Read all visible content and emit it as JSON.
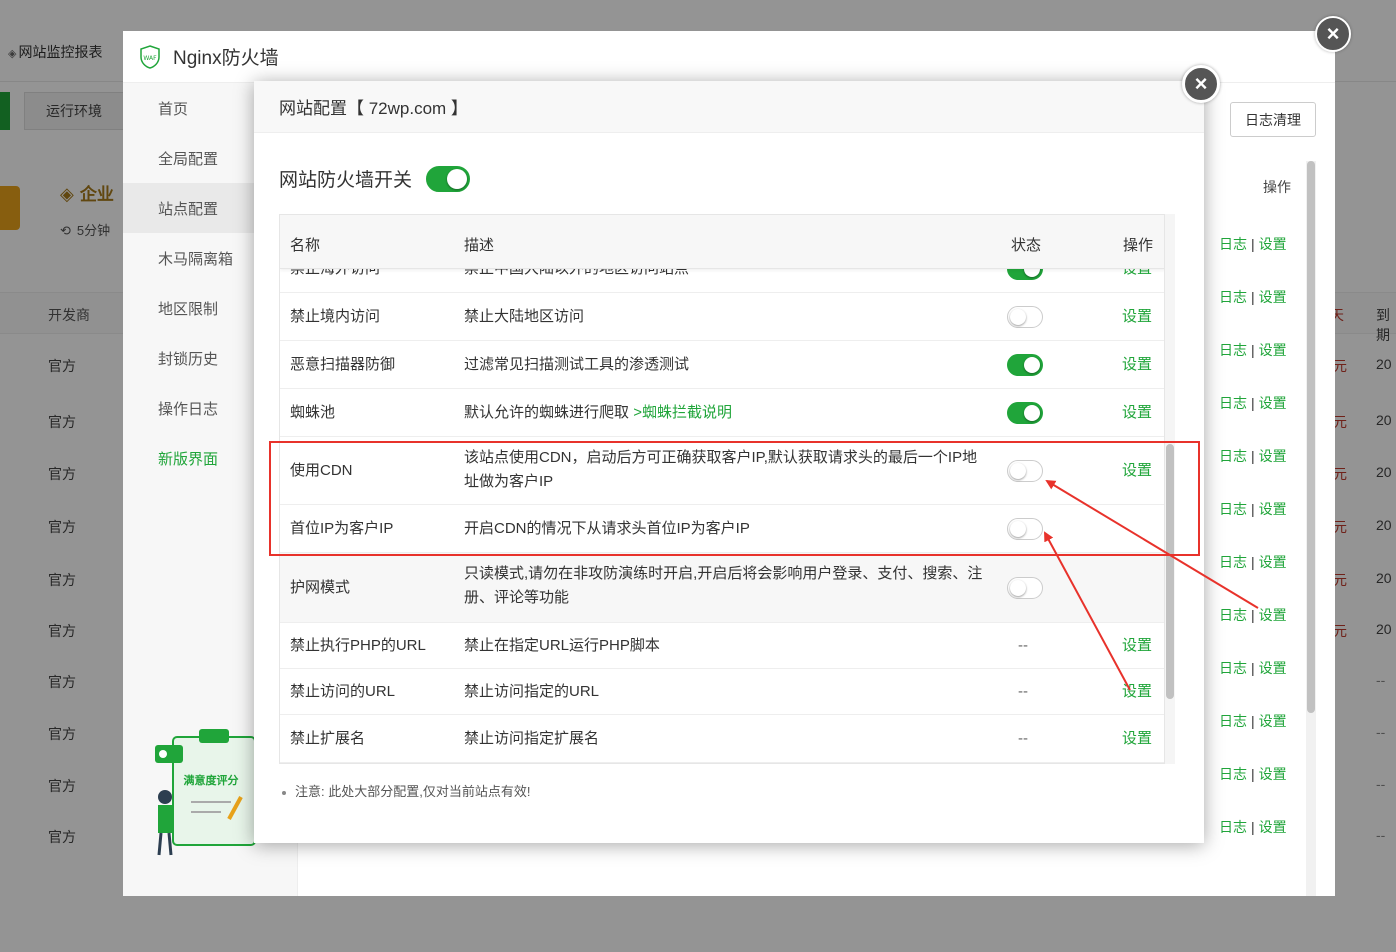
{
  "background": {
    "title": "网站监控报表",
    "tab_label": "运行环境",
    "enterprise_label": "企业",
    "enterprise_sub": "5分钟",
    "col_dev": "开发商",
    "official_rows": [
      "官方",
      "官方",
      "官方",
      "官方",
      "官方",
      "官方",
      "官方",
      "官方",
      "官方",
      "官方"
    ],
    "right_col_header": [
      "天",
      "到期"
    ],
    "right_col_items": [
      "元",
      "元",
      "元",
      "元",
      "元",
      "元"
    ],
    "right_col_years": [
      "20",
      "20",
      "20",
      "20",
      "20",
      "20"
    ],
    "right_col_dashes": [
      "--",
      "--",
      "--",
      "--"
    ]
  },
  "waf": {
    "title": "Nginx防火墙",
    "logo_text": "WAF",
    "close_glyph": "×",
    "nav": [
      {
        "label": "首页"
      },
      {
        "label": "全局配置"
      },
      {
        "label": "站点配置",
        "active": true
      },
      {
        "label": "木马隔离箱"
      },
      {
        "label": "地区限制"
      },
      {
        "label": "封锁历史"
      },
      {
        "label": "操作日志"
      },
      {
        "label": "新版界面",
        "green": true
      }
    ],
    "survey_label": "满意度评分",
    "log_clear_button": "日志清理",
    "op_header": "操作",
    "row_links": {
      "log": "日志",
      "sep": "|",
      "set": "设置"
    },
    "row_count": 12
  },
  "modal": {
    "title": "网站配置【 72wp.com 】",
    "close_glyph": "×",
    "firewall_switch_label": "网站防火墙开关",
    "firewall_switch_on": true,
    "columns": {
      "name": "名称",
      "desc": "描述",
      "status": "状态",
      "op": "操作"
    },
    "rows": [
      {
        "name": "禁止海外访问",
        "desc": "禁止中国大陆以外的地区访问站点",
        "status": "on",
        "op": "设置"
      },
      {
        "name": "禁止境内访问",
        "desc": "禁止大陆地区访问",
        "status": "off",
        "op": "设置"
      },
      {
        "name": "恶意扫描器防御",
        "desc": "过滤常见扫描测试工具的渗透测试",
        "status": "on",
        "op": "设置"
      },
      {
        "name": "蜘蛛池",
        "desc": "默认允许的蜘蛛进行爬取",
        "desc_link": ">蜘蛛拦截说明",
        "status": "on",
        "op": "设置"
      },
      {
        "name": "使用CDN",
        "desc": "该站点使用CDN，启动后方可正确获取客户IP,默认获取请求头的最后一个IP地址做为客户IP",
        "status": "off",
        "op": "设置"
      },
      {
        "name": "首位IP为客户IP",
        "desc": "开启CDN的情况下从请求头首位IP为客户IP",
        "status": "off",
        "op": ""
      },
      {
        "name": "护网模式",
        "desc": "只读模式,请勿在非攻防演练时开启,开启后将会影响用户登录、支付、搜索、注册、评论等功能",
        "status": "off",
        "op": ""
      },
      {
        "name": "禁止执行PHP的URL",
        "desc": "禁止在指定URL运行PHP脚本",
        "status": "--",
        "op": "设置"
      },
      {
        "name": "禁止访问的URL",
        "desc": "禁止访问指定的URL",
        "status": "--",
        "op": "设置"
      },
      {
        "name": "禁止扩展名",
        "desc": "禁止访问指定扩展名",
        "status": "--",
        "op": "设置"
      }
    ],
    "note": "注意: 此处大部分配置,仅对当前站点有效!"
  },
  "colors": {
    "accent": "#20a53a",
    "annotation": "#e8322b"
  }
}
